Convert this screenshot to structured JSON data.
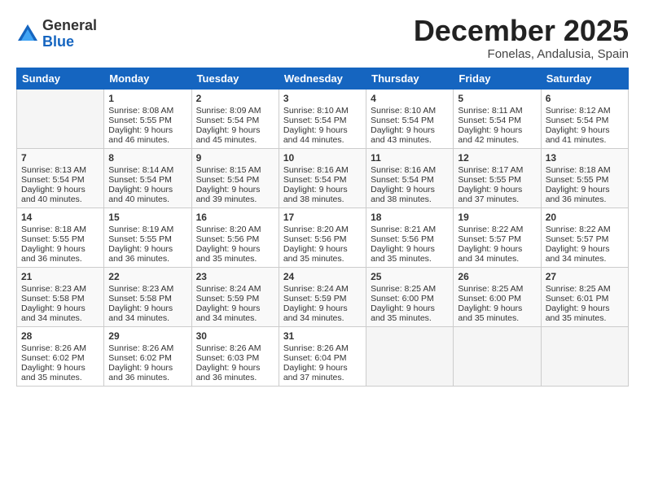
{
  "header": {
    "logo_general": "General",
    "logo_blue": "Blue",
    "month_title": "December 2025",
    "location": "Fonelas, Andalusia, Spain"
  },
  "days_of_week": [
    "Sunday",
    "Monday",
    "Tuesday",
    "Wednesday",
    "Thursday",
    "Friday",
    "Saturday"
  ],
  "weeks": [
    [
      {
        "day": "",
        "sunrise": "",
        "sunset": "",
        "daylight": ""
      },
      {
        "day": "1",
        "sunrise": "Sunrise: 8:08 AM",
        "sunset": "Sunset: 5:55 PM",
        "daylight": "Daylight: 9 hours and 46 minutes."
      },
      {
        "day": "2",
        "sunrise": "Sunrise: 8:09 AM",
        "sunset": "Sunset: 5:54 PM",
        "daylight": "Daylight: 9 hours and 45 minutes."
      },
      {
        "day": "3",
        "sunrise": "Sunrise: 8:10 AM",
        "sunset": "Sunset: 5:54 PM",
        "daylight": "Daylight: 9 hours and 44 minutes."
      },
      {
        "day": "4",
        "sunrise": "Sunrise: 8:10 AM",
        "sunset": "Sunset: 5:54 PM",
        "daylight": "Daylight: 9 hours and 43 minutes."
      },
      {
        "day": "5",
        "sunrise": "Sunrise: 8:11 AM",
        "sunset": "Sunset: 5:54 PM",
        "daylight": "Daylight: 9 hours and 42 minutes."
      },
      {
        "day": "6",
        "sunrise": "Sunrise: 8:12 AM",
        "sunset": "Sunset: 5:54 PM",
        "daylight": "Daylight: 9 hours and 41 minutes."
      }
    ],
    [
      {
        "day": "7",
        "sunrise": "Sunrise: 8:13 AM",
        "sunset": "Sunset: 5:54 PM",
        "daylight": "Daylight: 9 hours and 40 minutes."
      },
      {
        "day": "8",
        "sunrise": "Sunrise: 8:14 AM",
        "sunset": "Sunset: 5:54 PM",
        "daylight": "Daylight: 9 hours and 40 minutes."
      },
      {
        "day": "9",
        "sunrise": "Sunrise: 8:15 AM",
        "sunset": "Sunset: 5:54 PM",
        "daylight": "Daylight: 9 hours and 39 minutes."
      },
      {
        "day": "10",
        "sunrise": "Sunrise: 8:16 AM",
        "sunset": "Sunset: 5:54 PM",
        "daylight": "Daylight: 9 hours and 38 minutes."
      },
      {
        "day": "11",
        "sunrise": "Sunrise: 8:16 AM",
        "sunset": "Sunset: 5:54 PM",
        "daylight": "Daylight: 9 hours and 38 minutes."
      },
      {
        "day": "12",
        "sunrise": "Sunrise: 8:17 AM",
        "sunset": "Sunset: 5:55 PM",
        "daylight": "Daylight: 9 hours and 37 minutes."
      },
      {
        "day": "13",
        "sunrise": "Sunrise: 8:18 AM",
        "sunset": "Sunset: 5:55 PM",
        "daylight": "Daylight: 9 hours and 36 minutes."
      }
    ],
    [
      {
        "day": "14",
        "sunrise": "Sunrise: 8:18 AM",
        "sunset": "Sunset: 5:55 PM",
        "daylight": "Daylight: 9 hours and 36 minutes."
      },
      {
        "day": "15",
        "sunrise": "Sunrise: 8:19 AM",
        "sunset": "Sunset: 5:55 PM",
        "daylight": "Daylight: 9 hours and 36 minutes."
      },
      {
        "day": "16",
        "sunrise": "Sunrise: 8:20 AM",
        "sunset": "Sunset: 5:56 PM",
        "daylight": "Daylight: 9 hours and 35 minutes."
      },
      {
        "day": "17",
        "sunrise": "Sunrise: 8:20 AM",
        "sunset": "Sunset: 5:56 PM",
        "daylight": "Daylight: 9 hours and 35 minutes."
      },
      {
        "day": "18",
        "sunrise": "Sunrise: 8:21 AM",
        "sunset": "Sunset: 5:56 PM",
        "daylight": "Daylight: 9 hours and 35 minutes."
      },
      {
        "day": "19",
        "sunrise": "Sunrise: 8:22 AM",
        "sunset": "Sunset: 5:57 PM",
        "daylight": "Daylight: 9 hours and 34 minutes."
      },
      {
        "day": "20",
        "sunrise": "Sunrise: 8:22 AM",
        "sunset": "Sunset: 5:57 PM",
        "daylight": "Daylight: 9 hours and 34 minutes."
      }
    ],
    [
      {
        "day": "21",
        "sunrise": "Sunrise: 8:23 AM",
        "sunset": "Sunset: 5:58 PM",
        "daylight": "Daylight: 9 hours and 34 minutes."
      },
      {
        "day": "22",
        "sunrise": "Sunrise: 8:23 AM",
        "sunset": "Sunset: 5:58 PM",
        "daylight": "Daylight: 9 hours and 34 minutes."
      },
      {
        "day": "23",
        "sunrise": "Sunrise: 8:24 AM",
        "sunset": "Sunset: 5:59 PM",
        "daylight": "Daylight: 9 hours and 34 minutes."
      },
      {
        "day": "24",
        "sunrise": "Sunrise: 8:24 AM",
        "sunset": "Sunset: 5:59 PM",
        "daylight": "Daylight: 9 hours and 34 minutes."
      },
      {
        "day": "25",
        "sunrise": "Sunrise: 8:25 AM",
        "sunset": "Sunset: 6:00 PM",
        "daylight": "Daylight: 9 hours and 35 minutes."
      },
      {
        "day": "26",
        "sunrise": "Sunrise: 8:25 AM",
        "sunset": "Sunset: 6:00 PM",
        "daylight": "Daylight: 9 hours and 35 minutes."
      },
      {
        "day": "27",
        "sunrise": "Sunrise: 8:25 AM",
        "sunset": "Sunset: 6:01 PM",
        "daylight": "Daylight: 9 hours and 35 minutes."
      }
    ],
    [
      {
        "day": "28",
        "sunrise": "Sunrise: 8:26 AM",
        "sunset": "Sunset: 6:02 PM",
        "daylight": "Daylight: 9 hours and 35 minutes."
      },
      {
        "day": "29",
        "sunrise": "Sunrise: 8:26 AM",
        "sunset": "Sunset: 6:02 PM",
        "daylight": "Daylight: 9 hours and 36 minutes."
      },
      {
        "day": "30",
        "sunrise": "Sunrise: 8:26 AM",
        "sunset": "Sunset: 6:03 PM",
        "daylight": "Daylight: 9 hours and 36 minutes."
      },
      {
        "day": "31",
        "sunrise": "Sunrise: 8:26 AM",
        "sunset": "Sunset: 6:04 PM",
        "daylight": "Daylight: 9 hours and 37 minutes."
      },
      {
        "day": "",
        "sunrise": "",
        "sunset": "",
        "daylight": ""
      },
      {
        "day": "",
        "sunrise": "",
        "sunset": "",
        "daylight": ""
      },
      {
        "day": "",
        "sunrise": "",
        "sunset": "",
        "daylight": ""
      }
    ]
  ]
}
